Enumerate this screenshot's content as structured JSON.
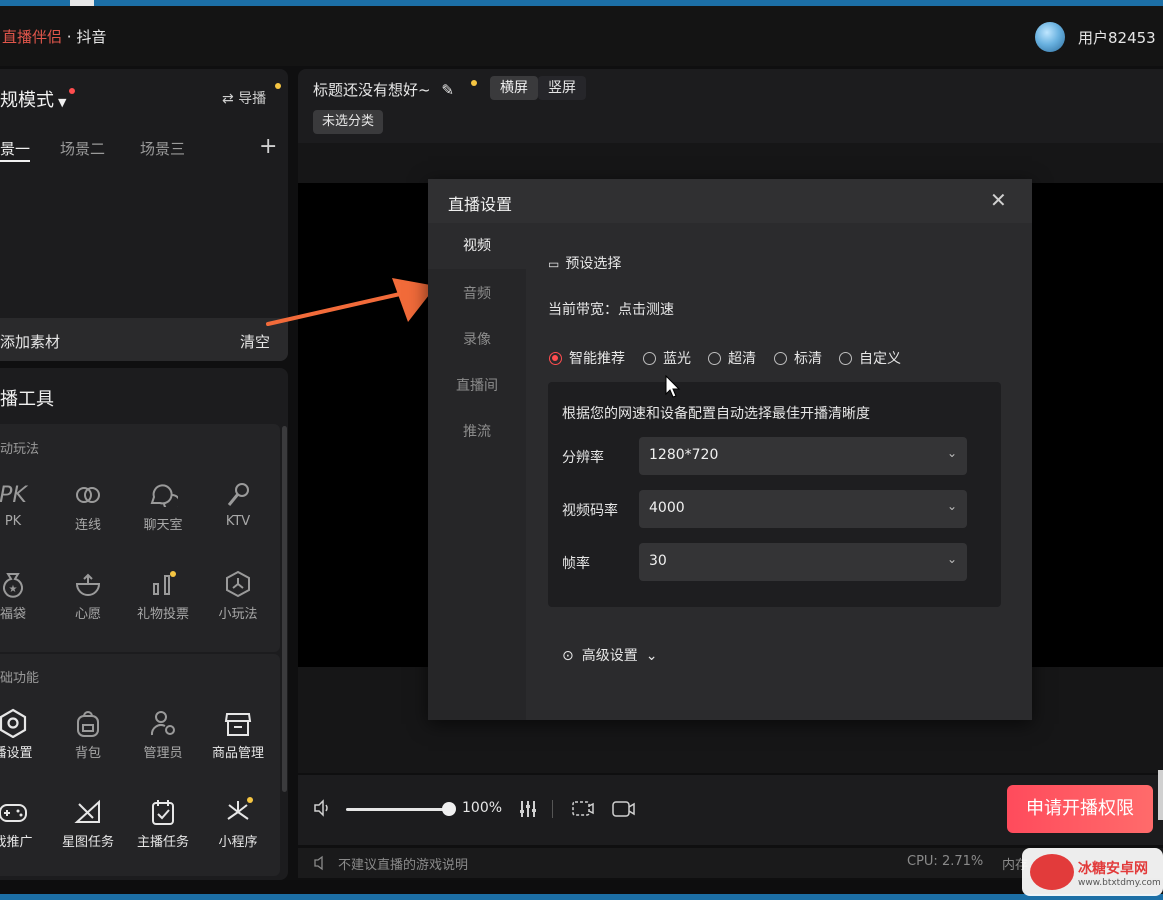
{
  "app": {
    "brand": "直播伴侣",
    "platform": "· 抖音",
    "username": "用户82453"
  },
  "scene_panel": {
    "mode_label": "规模式",
    "guide_label": "导播",
    "tabs": [
      {
        "label": "景一",
        "active": true
      },
      {
        "label": "场景二",
        "active": false
      },
      {
        "label": "场景三",
        "active": false
      }
    ],
    "add_material": "添加素材",
    "clear": "清空"
  },
  "tools": {
    "title": "播工具",
    "section1": {
      "label": "动玩法",
      "items": [
        {
          "label": "PK",
          "icon": "pk-icon"
        },
        {
          "label": "连线",
          "icon": "link-icon"
        },
        {
          "label": "聊天室",
          "icon": "chatroom-icon"
        },
        {
          "label": "KTV",
          "icon": "microphone-icon"
        },
        {
          "label": "福袋",
          "icon": "lucky-bag-icon"
        },
        {
          "label": "心愿",
          "icon": "wish-icon"
        },
        {
          "label": "礼物投票",
          "icon": "gift-vote-icon"
        },
        {
          "label": "小玩法",
          "icon": "mini-game-icon"
        }
      ]
    },
    "section2": {
      "label": "础功能",
      "items": [
        {
          "label": "播设置",
          "icon": "settings-hex-icon"
        },
        {
          "label": "背包",
          "icon": "backpack-icon"
        },
        {
          "label": "管理员",
          "icon": "admin-icon"
        },
        {
          "label": "商品管理",
          "icon": "shop-icon"
        },
        {
          "label": "戏推广",
          "icon": "gamepad-icon"
        },
        {
          "label": "星图任务",
          "icon": "star-map-icon"
        },
        {
          "label": "主播任务",
          "icon": "task-icon"
        },
        {
          "label": "小程序",
          "icon": "mini-program-icon"
        }
      ]
    }
  },
  "preview": {
    "stream_title": "标题还没有想好~",
    "landscape": "横屏",
    "portrait": "竖屏",
    "category": "未选分类"
  },
  "bottom": {
    "volume_percent": "100%",
    "volume_level": 1.0,
    "apply_button": "申请开播权限",
    "status_text": "不建议直播的游戏说明",
    "cpu": "CPU: 2.71%",
    "memory": "内存"
  },
  "dialog": {
    "title": "直播设置",
    "nav": [
      {
        "label": "视频",
        "active": true
      },
      {
        "label": "音频",
        "active": false
      },
      {
        "label": "录像",
        "active": false
      },
      {
        "label": "直播间",
        "active": false
      },
      {
        "label": "推流",
        "active": false
      }
    ],
    "preset_label": "预设选择",
    "bandwidth": "当前带宽：点击测速",
    "quality_options": [
      {
        "label": "智能推荐",
        "selected": true
      },
      {
        "label": "蓝光",
        "selected": false
      },
      {
        "label": "超清",
        "selected": false
      },
      {
        "label": "标清",
        "selected": false
      },
      {
        "label": "自定义",
        "selected": false
      }
    ],
    "auto_desc": "根据您的网速和设备配置自动选择最佳开播清晰度",
    "fields": [
      {
        "label": "分辨率",
        "value": "1280*720"
      },
      {
        "label": "视频码率",
        "value": "4000"
      },
      {
        "label": "帧率",
        "value": "30"
      }
    ],
    "advanced": "高级设置"
  },
  "watermark": {
    "name": "冰糖安卓网",
    "url": "www.btxtdmy.com"
  },
  "colors": {
    "accent": "#ff4d4f",
    "background": "#0f0f10",
    "panel": "#1c1c1e",
    "arrow": "#f26b3a"
  }
}
